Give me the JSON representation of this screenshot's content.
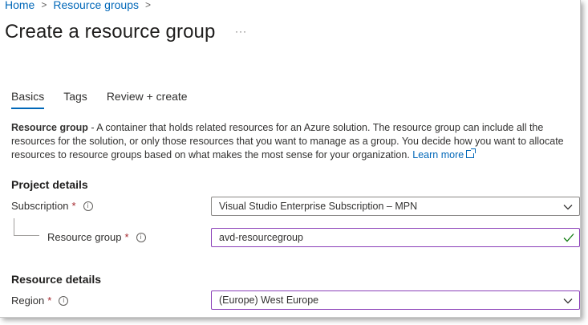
{
  "breadcrumb": {
    "home": "Home",
    "resource_groups": "Resource groups",
    "sep1": ">",
    "sep2": ">"
  },
  "page": {
    "title": "Create a resource group",
    "more": "···"
  },
  "tabs": [
    {
      "label": "Basics",
      "active": true
    },
    {
      "label": "Tags",
      "active": false
    },
    {
      "label": "Review + create",
      "active": false
    }
  ],
  "description": {
    "bold": "Resource group",
    "text": " - A container that holds related resources for an Azure solution. The resource group can include all the resources for the solution, or only those resources that you want to manage as a group. You decide how you want to allocate resources to resource groups based on what makes the most sense for your organization. ",
    "link": "Learn more"
  },
  "project_details": {
    "heading": "Project details",
    "subscription": {
      "label": "Subscription",
      "required": "*",
      "value": "Visual Studio Enterprise Subscription – MPN"
    },
    "resource_group": {
      "label": "Resource group",
      "required": "*",
      "value": "avd-resourcegroup"
    }
  },
  "resource_details": {
    "heading": "Resource details",
    "region": {
      "label": "Region",
      "required": "*",
      "value": "(Europe) West Europe"
    }
  },
  "colors": {
    "link": "#0067b8",
    "required": "#a4262c",
    "focus_border": "#8a3fb8",
    "valid_check": "#107c10"
  },
  "icons": {
    "info": "info-icon",
    "chevron": "chevron-down-icon",
    "check": "checkmark-icon",
    "external": "external-link-icon",
    "more": "more-icon"
  }
}
